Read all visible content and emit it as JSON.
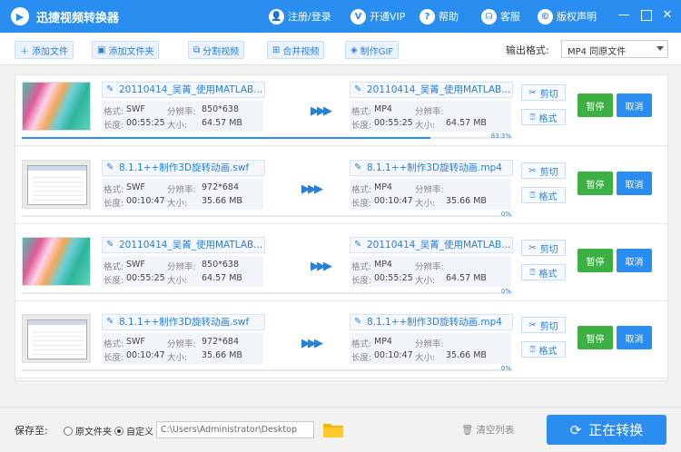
{
  "app": {
    "title": "迅捷视频转换器"
  },
  "header": {
    "links": [
      {
        "label": "注册/登录",
        "icon": "user-icon"
      },
      {
        "label": "开通VIP",
        "icon": "vip-icon"
      },
      {
        "label": "帮助",
        "icon": "help-icon"
      },
      {
        "label": "客服",
        "icon": "headset-icon"
      },
      {
        "label": "版权声明",
        "icon": "copyright-icon"
      }
    ]
  },
  "toolbar": {
    "buttons": [
      {
        "label": "添加文件",
        "icon": "plus-icon"
      },
      {
        "label": "添加文件夹",
        "icon": "folder-add-icon"
      },
      {
        "label": "分割视频",
        "icon": "split-icon"
      },
      {
        "label": "合并视频",
        "icon": "merge-icon"
      },
      {
        "label": "制作GIF",
        "icon": "gif-icon"
      }
    ],
    "output_format_label": "输出格式:",
    "output_format_value": "MP4  同原文件"
  },
  "labels": {
    "format": "格式:",
    "length": "长度:",
    "resolution": "分辨率:",
    "size": "大小:",
    "cut": "剪切",
    "format_btn": "格式",
    "pause": "暂停",
    "cancel": "取消"
  },
  "tasks": [
    {
      "source": {
        "name": "20110414_吴菁_使用MATLAB...",
        "format": "SWF",
        "length": "00:55:25",
        "resolution": "850*638",
        "size": "64.57 MB"
      },
      "output": {
        "name": "20110414_吴菁_使用MATLAB...",
        "format": "MP4",
        "length": "00:55:25",
        "resolution": "",
        "size": "64.57 MB"
      },
      "progress": 83.3,
      "progress_text": "83.3%"
    },
    {
      "source": {
        "name": "8.1.1++制作3D旋转动画.swf",
        "format": "SWF",
        "length": "00:10:47",
        "resolution": "972*684",
        "size": "35.66 MB"
      },
      "output": {
        "name": "8.1.1++制作3D旋转动画.mp4",
        "format": "MP4",
        "length": "00:10:47",
        "resolution": "",
        "size": "35.66 MB"
      },
      "progress": 0,
      "progress_text": "0%"
    },
    {
      "source": {
        "name": "20110414_吴菁_使用MATLAB...",
        "format": "SWF",
        "length": "00:55:25",
        "resolution": "850*638",
        "size": "64.57 MB"
      },
      "output": {
        "name": "20110414_吴菁_使用MATLAB...",
        "format": "MP4",
        "length": "00:55:25",
        "resolution": "",
        "size": "64.57 MB"
      },
      "progress": 0,
      "progress_text": "0%"
    },
    {
      "source": {
        "name": "8.1.1++制作3D旋转动画.swf",
        "format": "SWF",
        "length": "00:10:47",
        "resolution": "972*684",
        "size": "35.66 MB"
      },
      "output": {
        "name": "8.1.1++制作3D旋转动画.mp4",
        "format": "MP4",
        "length": "00:10:47",
        "resolution": "",
        "size": "35.66 MB"
      },
      "progress": 0,
      "progress_text": "0%"
    }
  ],
  "footer": {
    "save_label": "保存至:",
    "option_original": "原文件夹",
    "option_custom": "自定义",
    "selected_option": "custom",
    "path": "C:\\Users\\Administrator\\Desktop",
    "clear_label": "清空列表",
    "start_label": "正在转换"
  },
  "colors": {
    "primary": "#2a8ef0",
    "pause": "#3cb043",
    "text_blue": "#2a7fd6"
  }
}
